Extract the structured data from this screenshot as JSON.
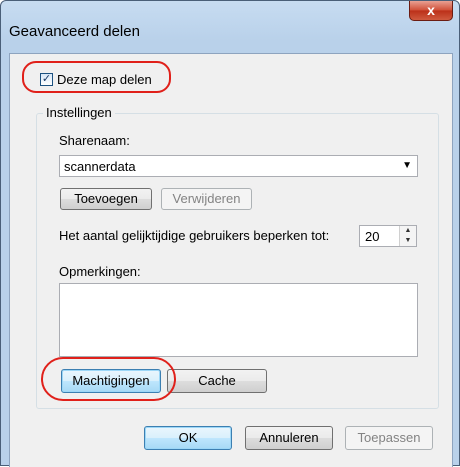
{
  "window": {
    "title": "Geavanceerd delen",
    "close_glyph": "x"
  },
  "share_checkbox": {
    "label": "Deze map delen",
    "checked": true
  },
  "settings": {
    "group_label": "Instellingen",
    "share_name_label": "Sharenaam:",
    "share_name_value": "scannerdata",
    "add_button": "Toevoegen",
    "remove_button": "Verwijderen",
    "limit_label": "Het aantal gelijktijdige gebruikers beperken tot:",
    "limit_value": "20",
    "comments_label": "Opmerkingen:",
    "comments_value": "",
    "permissions_button": "Machtigingen",
    "cache_button": "Cache"
  },
  "footer": {
    "ok": "OK",
    "cancel": "Annuleren",
    "apply": "Toepassen"
  },
  "colors": {
    "highlight_oval": "#e0201a",
    "title_bar": "#b9d1ea",
    "close_button": "#c9432b"
  }
}
